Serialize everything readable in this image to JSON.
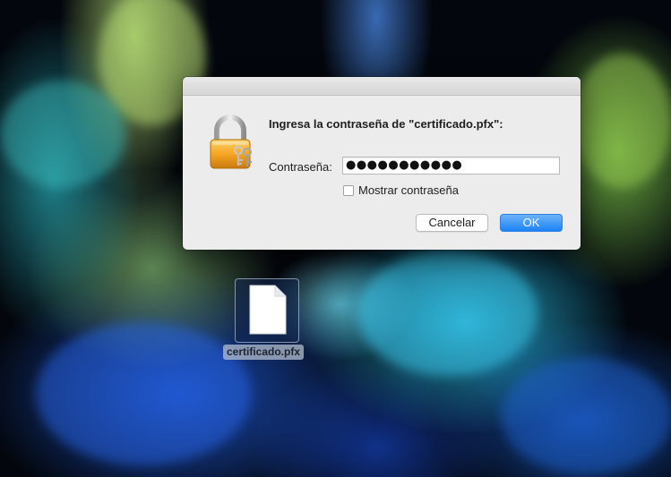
{
  "dialog": {
    "title": "Ingresa la contraseña de \"certificado.pfx\":",
    "password_label": "Contraseña:",
    "password_value": "●●●●●●●●●●●",
    "show_password_label": "Mostrar contraseña",
    "show_password_checked": false,
    "cancel_label": "Cancelar",
    "ok_label": "OK",
    "icon": "keychain-lock-icon"
  },
  "desktop": {
    "file": {
      "name": "certificado.pfx",
      "icon": "document-icon"
    }
  },
  "colors": {
    "accent": "#1d83f5",
    "dialog_bg": "#ececec",
    "lock_gold": "#f0a92a"
  }
}
